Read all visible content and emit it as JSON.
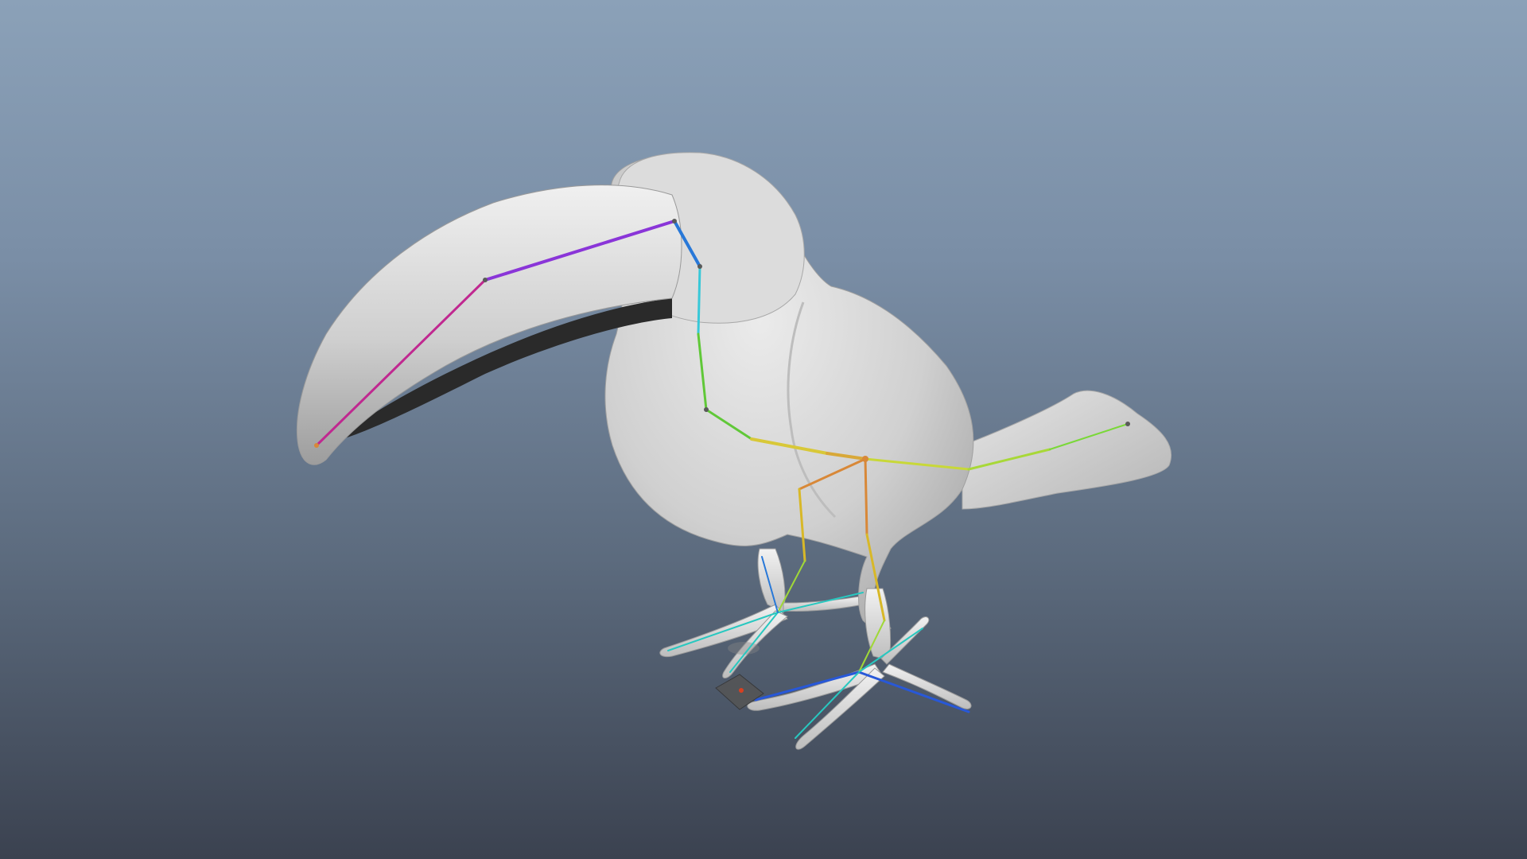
{
  "viewport": {
    "background_top": "#8ba1b8",
    "background_bottom": "#3b4250",
    "mesh_color": "#d6d6d6",
    "object": "toucan-mesh",
    "rig": "joint-skeleton"
  },
  "skeleton_colors": {
    "beak": "#c02890",
    "head": "#8a35d8",
    "neck_top": "#2878d8",
    "neck_mid": "#38c8d8",
    "spine": "#60c838",
    "hips": "#d8a838",
    "root": "#d88838",
    "tail": "#a8d838",
    "legs": "#d8b828",
    "toes": "#28c8c0",
    "toe_tips": "#2858d8"
  }
}
